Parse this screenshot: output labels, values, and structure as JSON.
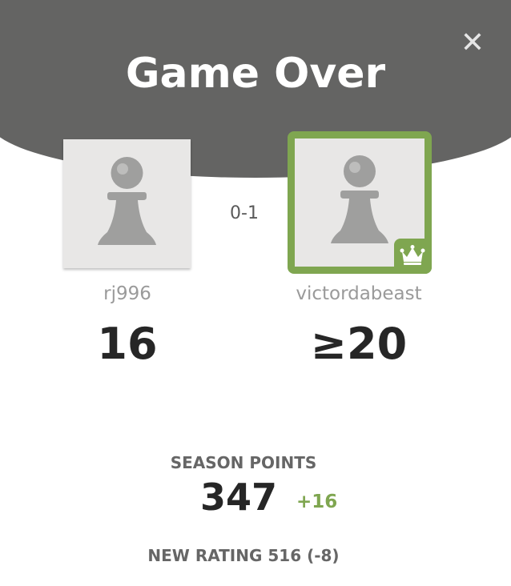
{
  "modal": {
    "title": "Game Over",
    "close_icon": "close-icon",
    "result_score": "0-1"
  },
  "players": [
    {
      "username": "rj996",
      "rating": "16",
      "avatar_icon": "pawn-icon",
      "winner": false
    },
    {
      "username": "victordabeast",
      "rating": "≥20",
      "avatar_icon": "pawn-icon",
      "winner": true,
      "badge_icon": "crown-icon"
    }
  ],
  "season": {
    "label": "SEASON POINTS",
    "points": "347",
    "delta": "+16"
  },
  "new_rating": "NEW RATING 516 (-8)",
  "colors": {
    "header_bg": "#646463",
    "winner_accent": "#7fa650",
    "board_light": "#eeeed2",
    "board_dark": "#769656",
    "text_dark": "#262626",
    "text_muted": "#9a9a9a"
  }
}
